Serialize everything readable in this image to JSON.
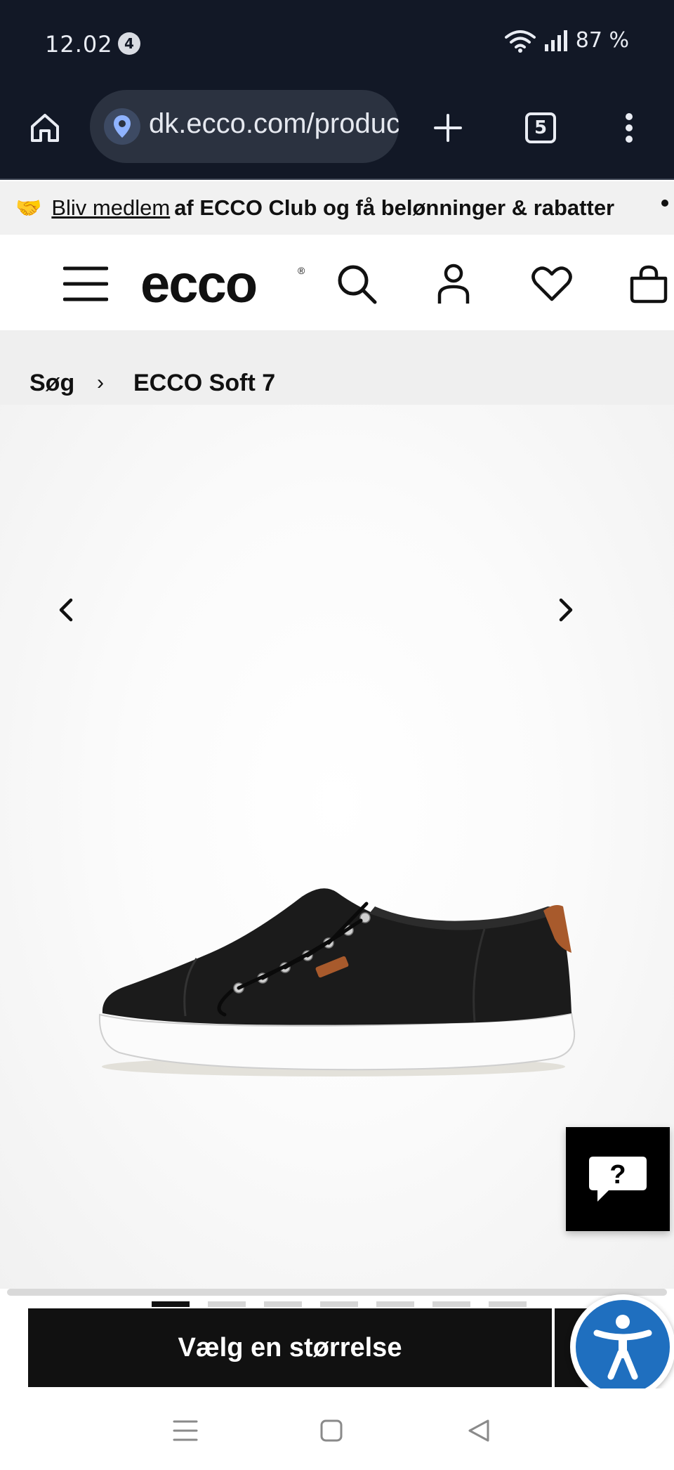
{
  "status_bar": {
    "time": "12.02",
    "notification_count": "4",
    "battery": "87 %"
  },
  "browser": {
    "url": "dk.ecco.com/product",
    "tabs_count": "5"
  },
  "promo": {
    "emoji": "🤝",
    "link_text": "Bliv medlem",
    "text": "af ECCO Club og få belønninger & rabatter"
  },
  "header": {
    "logo_text": "ecco",
    "icons": [
      "menu-icon",
      "search-icon",
      "account-icon",
      "heart-icon",
      "bag-icon"
    ]
  },
  "breadcrumb": {
    "items": [
      "Søg",
      "ECCO Soft 7"
    ],
    "separator": "›"
  },
  "gallery": {
    "prev": "‹",
    "next": "›",
    "image_count": 7,
    "active_index": 0
  },
  "chat": {
    "label": "?"
  },
  "cta": {
    "label": "Vælg en størrelse"
  },
  "colors": {
    "status_bg": "#121826",
    "cta_bg": "#111111",
    "accessibility_blue": "#1f6fbf",
    "promo_bg": "#f1f1f1"
  }
}
